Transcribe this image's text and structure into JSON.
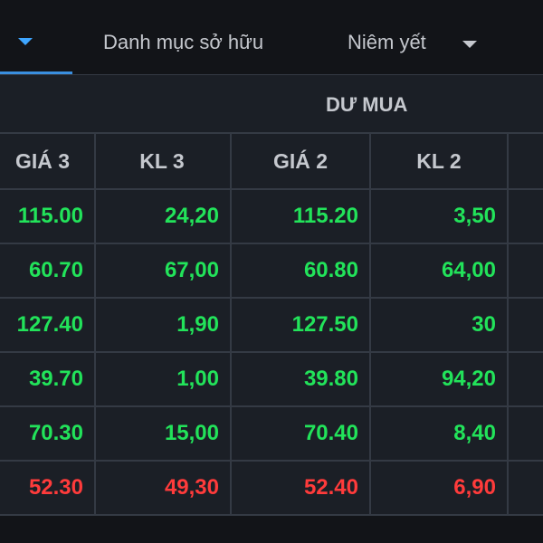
{
  "tabs": [
    {
      "label": "",
      "active": true
    },
    {
      "label": "Danh mục sở hữu",
      "active": false
    },
    {
      "label": "Niêm yết",
      "active": false,
      "has_dropdown": true
    }
  ],
  "table": {
    "group_header": "DƯ MUA",
    "columns": [
      "GIÁ 3",
      "KL 3",
      "GIÁ 2",
      "KL 2"
    ],
    "rows": [
      {
        "cells": [
          "115.00",
          "24,20",
          "115.20",
          "3,50"
        ],
        "color": "#22e35a"
      },
      {
        "cells": [
          "60.70",
          "67,00",
          "60.80",
          "64,00"
        ],
        "color": "#22e35a"
      },
      {
        "cells": [
          "127.40",
          "1,90",
          "127.50",
          "30"
        ],
        "color": "#22e35a"
      },
      {
        "cells": [
          "39.70",
          "1,00",
          "39.80",
          "94,20"
        ],
        "color": "#22e35a"
      },
      {
        "cells": [
          "70.30",
          "15,00",
          "70.40",
          "8,40"
        ],
        "color": "#22e35a"
      },
      {
        "cells": [
          "52.30",
          "49,30",
          "52.40",
          "6,90"
        ],
        "color": "#ff3b3b"
      }
    ]
  },
  "colors": {
    "up": "#22e35a",
    "down": "#ff3b3b",
    "accent": "#3a8fe0",
    "background": "#1b1f26",
    "text": "#c5c8ce"
  }
}
